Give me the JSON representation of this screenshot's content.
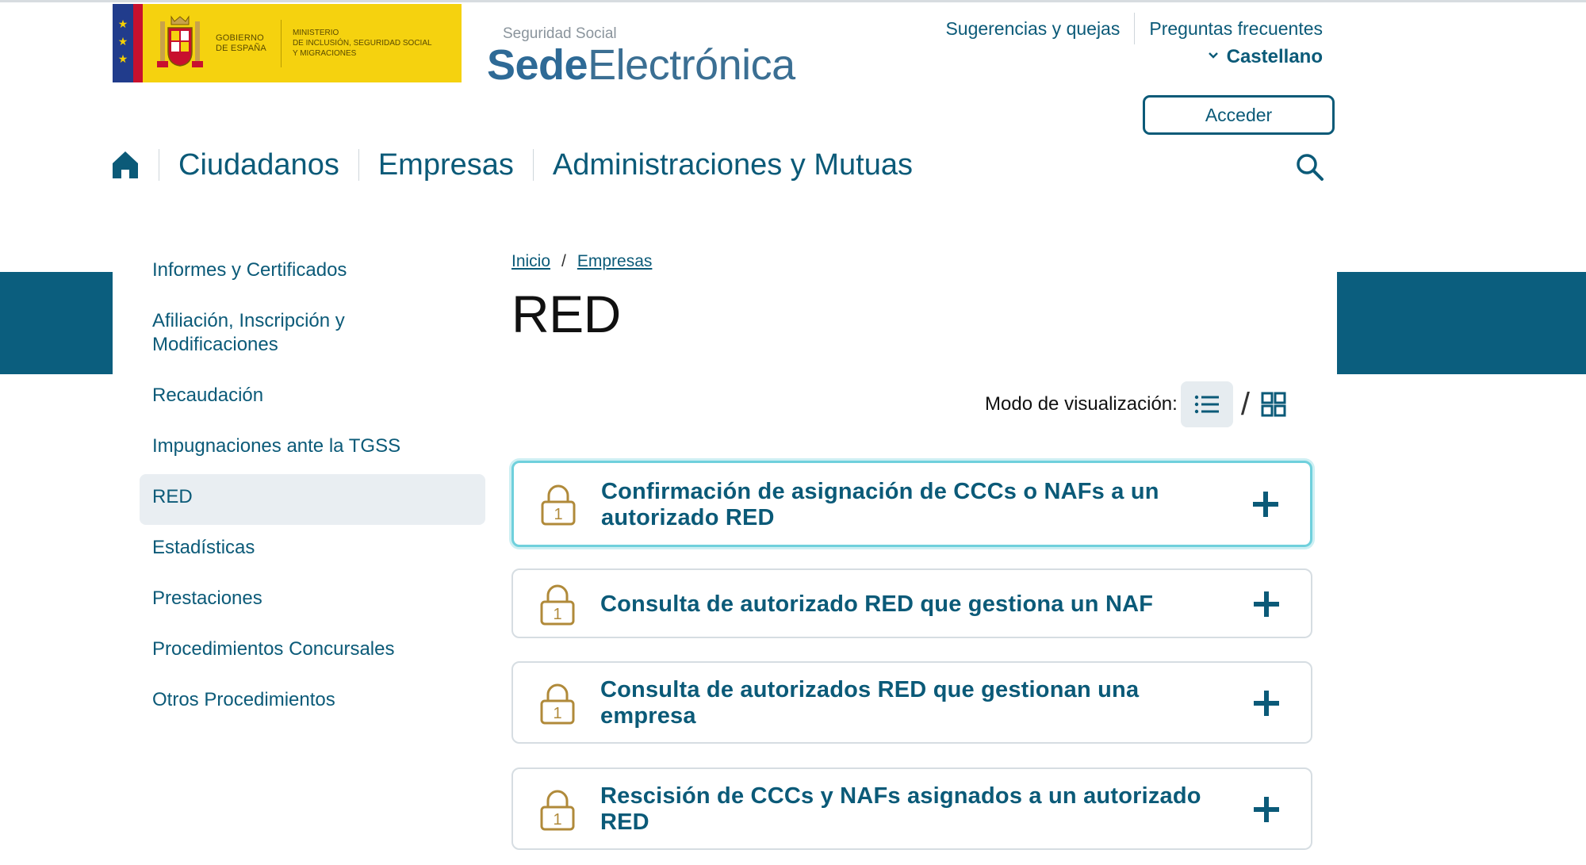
{
  "header": {
    "gov_logo": {
      "gobierno": "GOBIERNO\nDE ESPAÑA",
      "ministerio": "MINISTERIO\nDE INCLUSIÓN, SEGURIDAD SOCIAL\nY MIGRACIONES"
    },
    "sede": {
      "small": "Seguridad Social",
      "bold": "Sede",
      "rest": "Electrónica"
    },
    "links": {
      "sugerencias": "Sugerencias y quejas",
      "preguntas": "Preguntas frecuentes"
    },
    "language": "Castellano",
    "login_label": "Acceder"
  },
  "nav": {
    "items": [
      "Ciudadanos",
      "Empresas",
      "Administraciones y Mutuas"
    ],
    "icons": {
      "home": "home-icon",
      "search": "search-icon"
    }
  },
  "sidebar": {
    "items": [
      {
        "label": "Informes y Certificados"
      },
      {
        "label": "Afiliación, Inscripción y Modificaciones"
      },
      {
        "label": "Recaudación"
      },
      {
        "label": "Impugnaciones ante la TGSS"
      },
      {
        "label": "RED",
        "active": true
      },
      {
        "label": "Estadísticas"
      },
      {
        "label": "Prestaciones"
      },
      {
        "label": "Procedimientos Concursales"
      },
      {
        "label": "Otros Procedimientos"
      }
    ]
  },
  "breadcrumb": {
    "home": "Inicio",
    "section": "Empresas",
    "separator": "/"
  },
  "page": {
    "title": "RED",
    "view_mode_label": "Modo de visualización:",
    "view_mode_separator": "/"
  },
  "procedures": [
    {
      "title": "Confirmación de asignación de CCCs o NAFs a un autorizado RED",
      "lock_level": "1"
    },
    {
      "title": "Consulta de autorizado RED que gestiona un NAF",
      "lock_level": "1"
    },
    {
      "title": "Consulta de autorizados RED que gestionan una empresa",
      "lock_level": "1"
    },
    {
      "title": "Rescisión de CCCs y NAFs asignados a un autorizado RED",
      "lock_level": "1"
    }
  ],
  "colors": {
    "brand": "#0b5a78",
    "band": "#0b5e7e",
    "focus": "#6fd0dc",
    "lock": "#b08a3a",
    "gov_yellow": "#f5d20f"
  }
}
